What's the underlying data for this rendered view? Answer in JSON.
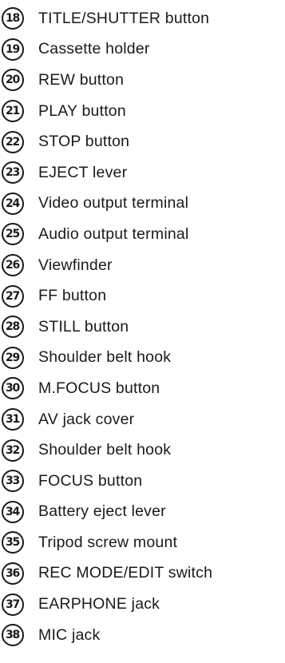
{
  "items": [
    {
      "number": "18",
      "label": "TITLE/SHUTTER button"
    },
    {
      "number": "19",
      "label": "Cassette holder"
    },
    {
      "number": "20",
      "label": "REW button"
    },
    {
      "number": "21",
      "label": "PLAY button"
    },
    {
      "number": "22",
      "label": "STOP button"
    },
    {
      "number": "23",
      "label": "EJECT lever"
    },
    {
      "number": "24",
      "label": "Video output terminal"
    },
    {
      "number": "25",
      "label": "Audio output terminal"
    },
    {
      "number": "26",
      "label": "Viewfinder"
    },
    {
      "number": "27",
      "label": "FF button"
    },
    {
      "number": "28",
      "label": "STILL button"
    },
    {
      "number": "29",
      "label": "Shoulder belt hook"
    },
    {
      "number": "30",
      "label": "M.FOCUS button"
    },
    {
      "number": "31",
      "label": "AV jack cover"
    },
    {
      "number": "32",
      "label": "Shoulder belt hook"
    },
    {
      "number": "33",
      "label": "FOCUS button"
    },
    {
      "number": "34",
      "label": "Battery eject lever"
    },
    {
      "number": "35",
      "label": "Tripod screw mount"
    },
    {
      "number": "36",
      "label": "REC MODE/EDIT switch"
    },
    {
      "number": "37",
      "label": "EARPHONE jack"
    },
    {
      "number": "38",
      "label": "MIC jack"
    }
  ]
}
